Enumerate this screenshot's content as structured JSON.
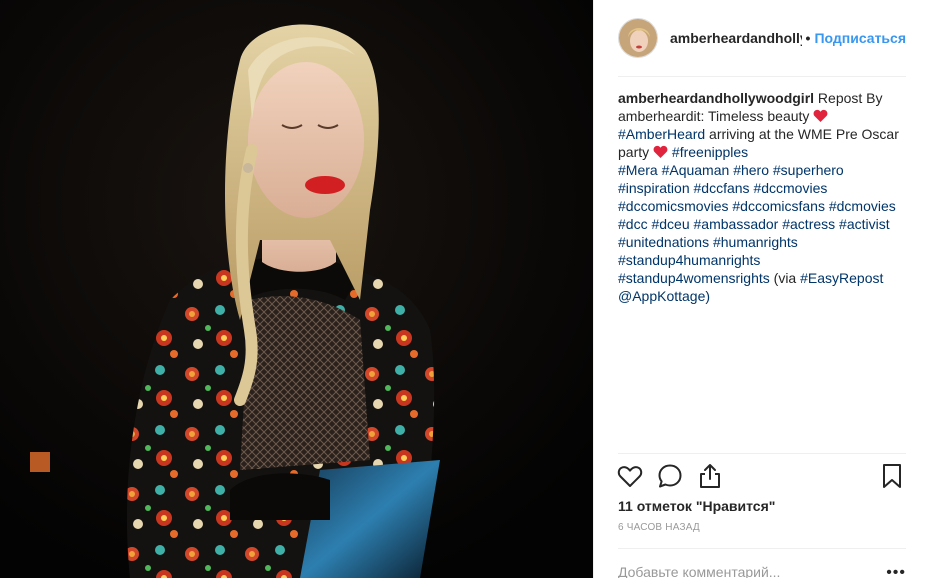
{
  "post": {
    "username_short": "amberheardandhollyw",
    "follow_label": "Подписаться",
    "dot": "•"
  },
  "caption": {
    "author": "amberheardandhollywoodgirl",
    "text1": "Repost By amberheardit: Timeless beauty",
    "tag_amberheard": "#AmberHeard",
    "text2": "arriving at the WME Pre Oscar party",
    "tag_freenipples": "#freenipples",
    "hashtags": [
      "#Mera",
      "#Aquaman",
      "#hero",
      "#superhero",
      "#inspiration",
      "#dccfans",
      "#dccmovies",
      "#dccomicsmovies",
      "#dccomicsfans",
      "#dcmovies",
      "#dcc",
      "#dceu",
      "#ambassador",
      "#actress",
      "#activist",
      "#unitednations",
      "#humanrights",
      "#standup4humanrights",
      "#standup4womensrights"
    ],
    "via_prefix": "(via",
    "tag_easyrepost": "#EasyRepost",
    "handle": "@AppKottage)"
  },
  "likes": {
    "text": "11 отметок \"Нравится\""
  },
  "timestamp": "6 часов назад",
  "comment": {
    "placeholder": "Добавьте комментарий...",
    "more_label": "•••"
  },
  "icons": {
    "like": "heart-outline-icon",
    "comment": "speech-bubble-icon",
    "share": "share-icon",
    "save": "bookmark-icon"
  },
  "colors": {
    "link": "#3897f0",
    "hashtag": "#003569",
    "heart": "#e0243e"
  }
}
